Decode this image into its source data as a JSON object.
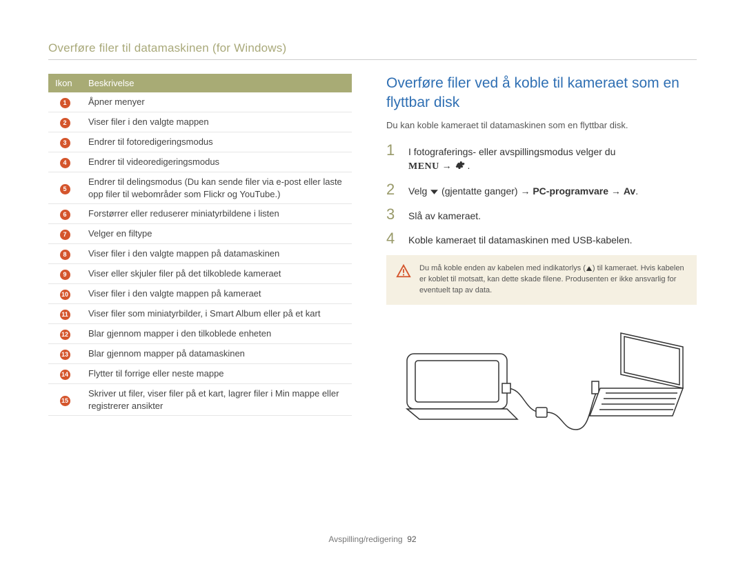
{
  "breadcrumb": "Overføre filer til datamaskinen (for Windows)",
  "table": {
    "col_icon": "Ikon",
    "col_desc": "Beskrivelse",
    "rows": [
      {
        "n": "1",
        "desc": "Åpner menyer"
      },
      {
        "n": "2",
        "desc": "Viser filer i den valgte mappen"
      },
      {
        "n": "3",
        "desc": "Endrer til fotoredigeringsmodus"
      },
      {
        "n": "4",
        "desc": "Endrer til videoredigeringsmodus"
      },
      {
        "n": "5",
        "desc": "Endrer til delingsmodus (Du kan sende filer via e-post eller laste opp filer til webområder som Flickr og YouTube.)"
      },
      {
        "n": "6",
        "desc": "Forstørrer eller reduserer miniatyrbildene i listen"
      },
      {
        "n": "7",
        "desc": "Velger en filtype"
      },
      {
        "n": "8",
        "desc": "Viser filer i den valgte mappen på datamaskinen"
      },
      {
        "n": "9",
        "desc": "Viser eller skjuler filer på det tilkoblede kameraet"
      },
      {
        "n": "10",
        "desc": "Viser filer i den valgte mappen på kameraet"
      },
      {
        "n": "11",
        "desc": "Viser filer som miniatyrbilder, i Smart Album eller på et kart"
      },
      {
        "n": "12",
        "desc": "Blar gjennom mapper i den tilkoblede enheten"
      },
      {
        "n": "13",
        "desc": "Blar gjennom mapper på datamaskinen"
      },
      {
        "n": "14",
        "desc": "Flytter til forrige eller neste mappe"
      },
      {
        "n": "15",
        "desc": "Skriver ut filer, viser filer på et kart, lagrer filer i Min mappe eller registrerer ansikter"
      }
    ]
  },
  "section_title": "Overføre filer ved å koble til kameraet som en flyttbar disk",
  "intro": "Du kan koble kameraet til datamaskinen som en flyttbar disk.",
  "steps": {
    "s1": {
      "num": "1",
      "text_a": "I fotograferings- eller avspillingsmodus velger du",
      "menu_word": "MENU",
      "arrow": "→"
    },
    "s2": {
      "num": "2",
      "text_a": "Velg ",
      "repeat": " (gjentatte ganger) ",
      "arrow": "→",
      "bold1": "PC-programvare",
      "bold2": "Av",
      "dot": "."
    },
    "s3": {
      "num": "3",
      "text": "Slå av kameraet."
    },
    "s4": {
      "num": "4",
      "text": "Koble kameraet til datamaskinen med USB-kabelen."
    }
  },
  "warning": {
    "line1a": "Du må koble enden av kabelen med indikatorlys (",
    "line1b": ") til kameraet. Hvis kabelen er koblet til motsatt, kan dette skade filene. Produsenten er ikke ansvarlig for eventuelt tap av data."
  },
  "footer": {
    "section": "Avspilling/redigering",
    "page": "92"
  }
}
